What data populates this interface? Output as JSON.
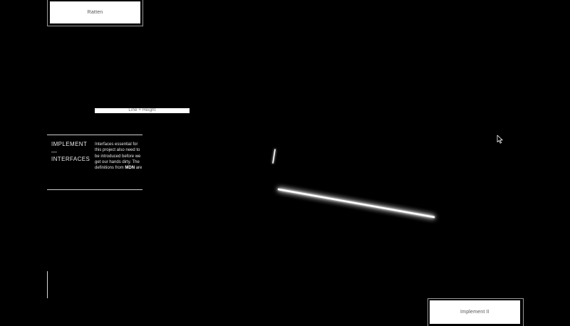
{
  "nav": {
    "top_button_label": "Ratten",
    "line_height_label": "Line + Height",
    "bottom_button_label": "Implement II"
  },
  "section": {
    "heading_line1": "IMPLEMENT",
    "heading_line2": "—",
    "heading_line3": "INTERFACES",
    "body_text": "Interfaces essential for this project also need to be introduced before we get our hands dirty. The definitions from",
    "body_bold": "MDN",
    "body_tail": "are"
  },
  "colors": {
    "background": "#000000",
    "foreground": "#ffffff",
    "glow": "#ffffff"
  },
  "icons": {
    "pointer": "mouse-pointer-icon"
  }
}
